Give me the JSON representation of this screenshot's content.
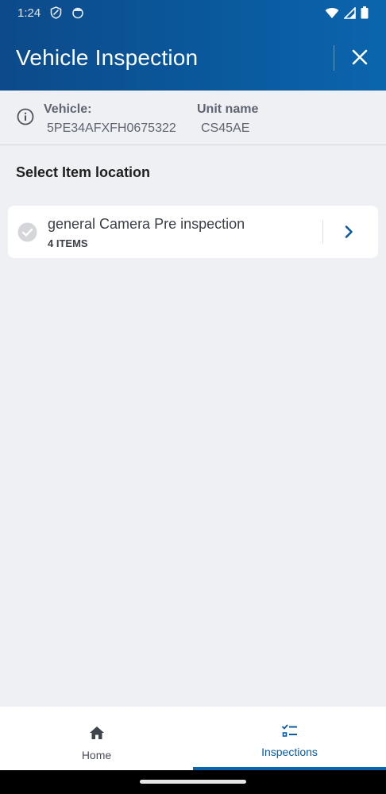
{
  "status_bar": {
    "time": "1:24",
    "left_icons": [
      "shield-icon",
      "face-icon"
    ],
    "right_icons": [
      "wifi-icon",
      "signal-icon",
      "battery-icon"
    ]
  },
  "header": {
    "title": "Vehicle Inspection",
    "close_icon": "close-icon",
    "background_color": "#0b5aa0"
  },
  "vehicle_info": {
    "icon": "info-icon",
    "vehicle_label": "Vehicle:",
    "vehicle_value": "5PE34AFXFH0675322",
    "unit_label": "Unit name",
    "unit_value": "CS45AE"
  },
  "section": {
    "heading": "Select Item location"
  },
  "locations": [
    {
      "title": "general Camera Pre inspection",
      "count": "4 ITEMS",
      "status_icon": "check-circle-icon",
      "action_icon": "chevron-right-icon"
    }
  ],
  "bottom_nav": {
    "items": [
      {
        "label": "Home",
        "icon": "home-icon",
        "active": false
      },
      {
        "label": "Inspections",
        "icon": "checklist-icon",
        "active": true
      }
    ],
    "accent_color": "#0b65ad"
  }
}
